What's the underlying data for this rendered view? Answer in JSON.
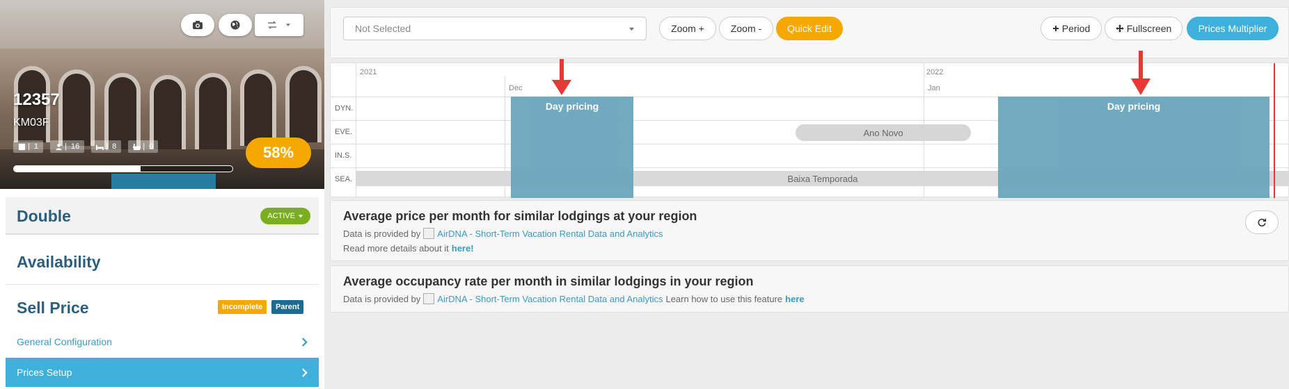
{
  "property": {
    "id": "12357",
    "code": "KM03F",
    "chips": [
      "1",
      "16",
      "8",
      "0"
    ],
    "occupancy_pct_label": "58%",
    "progress_fraction": 0.58
  },
  "sections": {
    "double": {
      "title": "Double",
      "status": "ACTIVE"
    },
    "availability": {
      "title": "Availability"
    },
    "sell_price": {
      "title": "Sell Price",
      "tag_incomplete": "Incomplete",
      "tag_parent": "Parent"
    },
    "general_configuration": "General Configuration",
    "prices_setup": "Prices Setup"
  },
  "toolbar": {
    "select_placeholder": "Not Selected",
    "zoom_in": "Zoom +",
    "zoom_out": "Zoom -",
    "quick_edit": "Quick Edit",
    "period": "Period",
    "fullscreen": "Fullscreen",
    "prices_multiplier": "Prices Multiplier"
  },
  "timeline": {
    "years": [
      "2021",
      "2022"
    ],
    "months": [
      "Dec",
      "Jan"
    ],
    "rows": [
      "DYN.",
      "EVE.",
      "IN.S.",
      "SEA."
    ],
    "day_pricing": "Day pricing",
    "event": "Ano Novo",
    "season": "Baixa Temporada"
  },
  "cards": {
    "price": {
      "title": "Average price per month for similar lodgings at your region",
      "provided_by": "Data is provided by",
      "airdna": "AirDNA - Short-Term Vacation Rental Data and Analytics",
      "read_more": "Read more details about it",
      "here": "here!"
    },
    "occupancy": {
      "title": "Average occupancy rate per month in similar lodgings in your region",
      "provided_by": "Data is provided by",
      "airdna": "AirDNA - Short-Term Vacation Rental Data and Analytics",
      "learn": "Learn how to use this feature",
      "here": "here"
    }
  }
}
